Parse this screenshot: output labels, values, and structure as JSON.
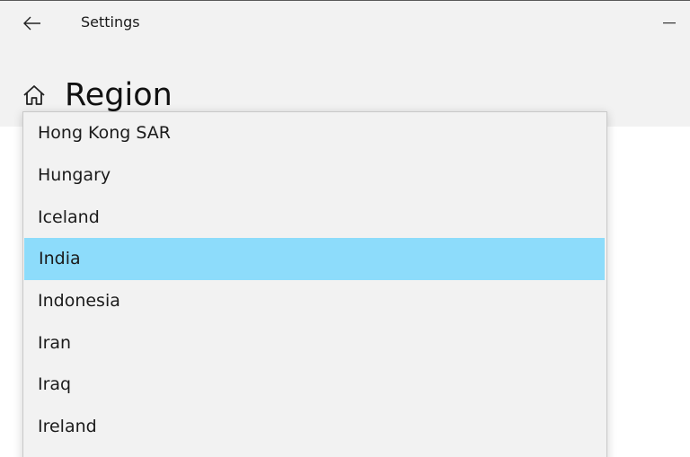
{
  "window": {
    "title": "Settings",
    "back_icon": "back-arrow-icon",
    "minimize_icon": "minimize-icon"
  },
  "page": {
    "title": "Region",
    "icon": "home-icon"
  },
  "country_dropdown": {
    "options": [
      {
        "label": "Hong Kong SAR",
        "selected": false
      },
      {
        "label": "Hungary",
        "selected": false
      },
      {
        "label": "Iceland",
        "selected": false
      },
      {
        "label": "India",
        "selected": true
      },
      {
        "label": "Indonesia",
        "selected": false
      },
      {
        "label": "Iran",
        "selected": false
      },
      {
        "label": "Iraq",
        "selected": false
      },
      {
        "label": "Ireland",
        "selected": false
      }
    ],
    "selected_color": "#8ddcfb",
    "background_color": "#f2f2f2"
  }
}
